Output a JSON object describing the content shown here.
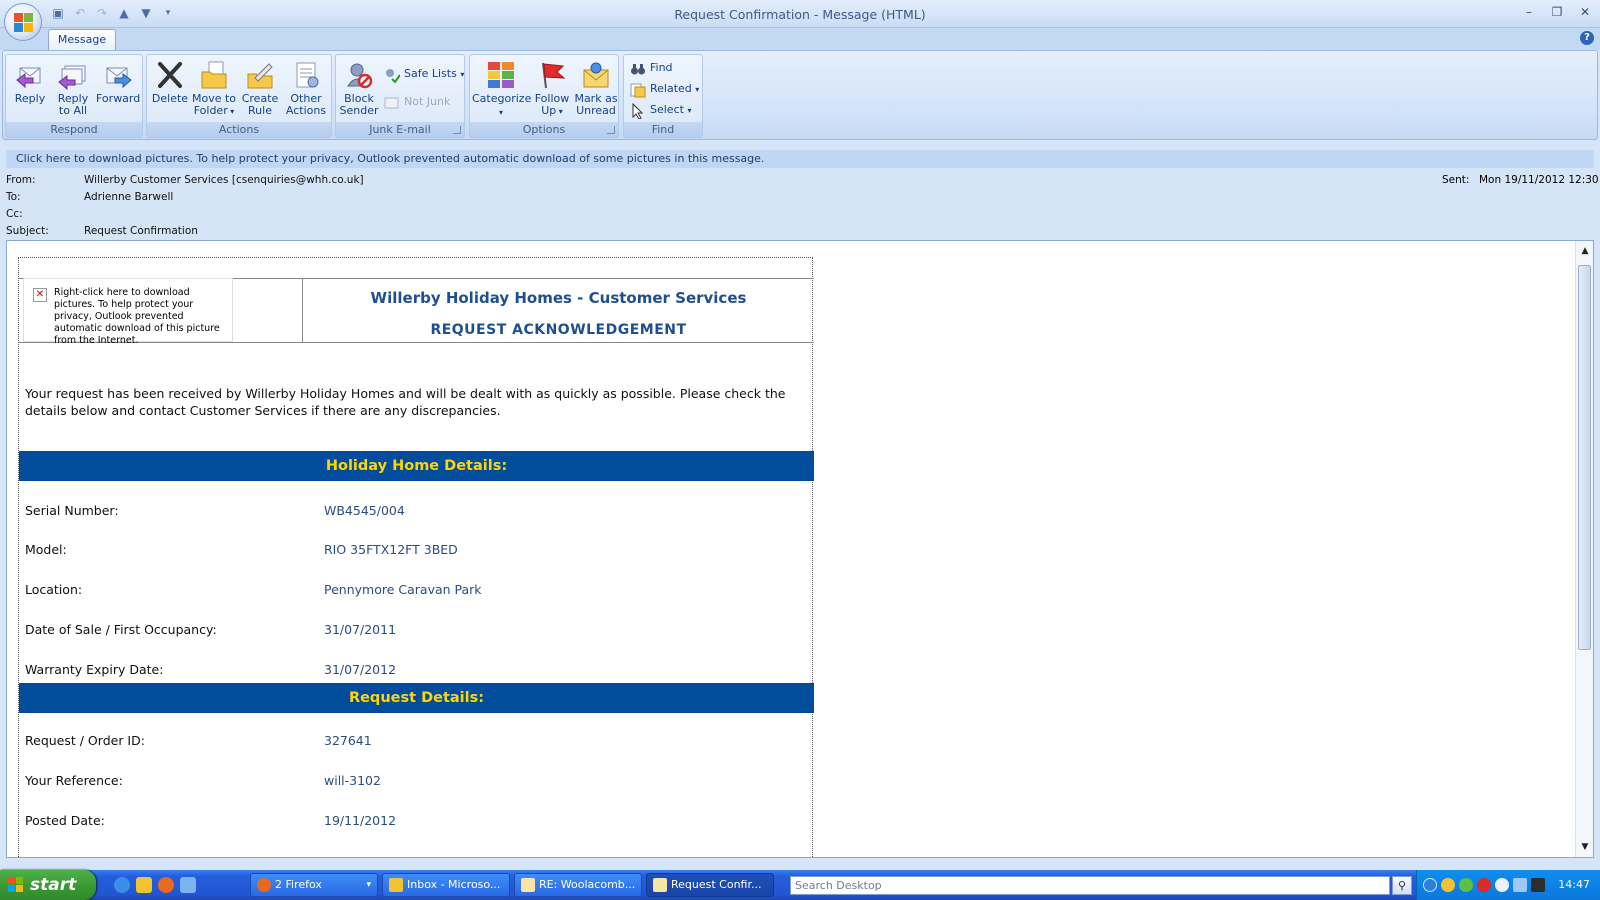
{
  "window": {
    "title": "Request Confirmation - Message (HTML)"
  },
  "ribbon": {
    "tab": "Message",
    "groups": {
      "respond": {
        "label": "Respond",
        "reply": "Reply",
        "reply_all_1": "Reply",
        "reply_all_2": "to All",
        "forward": "Forward"
      },
      "actions": {
        "label": "Actions",
        "delete": "Delete",
        "move_1": "Move to",
        "move_2": "Folder",
        "create_1": "Create",
        "create_2": "Rule",
        "other_1": "Other",
        "other_2": "Actions"
      },
      "junk": {
        "label": "Junk E-mail",
        "block_1": "Block",
        "block_2": "Sender",
        "safe_lists": "Safe Lists",
        "not_junk": "Not Junk"
      },
      "options": {
        "label": "Options",
        "categorize": "Categorize",
        "follow_1": "Follow",
        "follow_2": "Up",
        "mark_1": "Mark as",
        "mark_2": "Unread"
      },
      "find": {
        "label": "Find",
        "find": "Find",
        "related": "Related",
        "select": "Select"
      }
    }
  },
  "infobar": "Click here to download pictures. To help protect your privacy, Outlook prevented automatic download of some pictures in this message.",
  "header": {
    "from_label": "From:",
    "from": "Willerby Customer Services [csenquiries@whh.co.uk]",
    "to_label": "To:",
    "to": "Adrienne Barwell",
    "cc_label": "Cc:",
    "cc": "",
    "subject_label": "Subject:",
    "subject": "Request Confirmation",
    "sent_label": "Sent:",
    "sent": "Mon 19/11/2012 12:30"
  },
  "email": {
    "picture_notice": "Right-click here to download pictures. To help protect your privacy, Outlook prevented automatic download of this picture from the Internet.",
    "company": "Willerby Holiday Homes - Customer Services",
    "heading": "REQUEST ACKNOWLEDGEMENT",
    "intro": "Your request has been received by Willerby Holiday Homes and will be dealt with as quickly as possible. Please check the details below and contact Customer Services if there are any discrepancies.",
    "holiday_home_title": "Holiday Home Details:",
    "holiday_home": [
      {
        "label": "Serial Number:",
        "value": "WB4545/004"
      },
      {
        "label": "Model:",
        "value": "RIO 35FTX12FT 3BED"
      },
      {
        "label": "Location:",
        "value": "Pennymore Caravan Park"
      },
      {
        "label": "Date of Sale / First Occupancy:",
        "value": "31/07/2011"
      },
      {
        "label": "Warranty Expiry Date:",
        "value": "31/07/2012"
      }
    ],
    "request_title": "Request Details:",
    "request": [
      {
        "label": "Request / Order ID:",
        "value": "327641"
      },
      {
        "label": "Your Reference:",
        "value": "will-3102"
      },
      {
        "label": "Posted Date:",
        "value": "19/11/2012"
      }
    ]
  },
  "taskbar": {
    "start": "start",
    "tasks": [
      {
        "label": "2 Firefox",
        "icon": "firefox-icon"
      },
      {
        "label": "Inbox - Microso...",
        "icon": "outlook-icon"
      },
      {
        "label": "RE: Woolacomb...",
        "icon": "mail-icon"
      },
      {
        "label": "Request Confir...",
        "icon": "mail-icon"
      }
    ],
    "search_placeholder": "Search Desktop",
    "clock": "14:47"
  },
  "colors": {
    "band": "#024c9c",
    "band_text": "#ffd700",
    "accent": "#1f4f8f",
    "taskbar": "#245edc",
    "start": "#3c9a35"
  }
}
